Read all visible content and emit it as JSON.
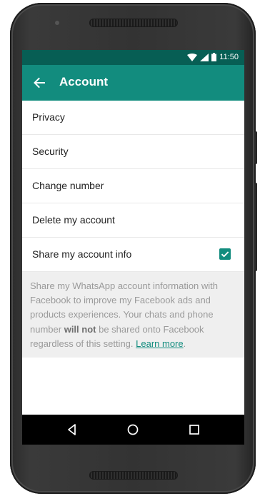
{
  "status_bar": {
    "time": "11:50",
    "icons": [
      "wifi-icon",
      "signal-icon",
      "battery-icon"
    ]
  },
  "app_bar": {
    "title": "Account",
    "back_icon": "back-arrow-icon"
  },
  "settings": {
    "items": [
      {
        "label": "Privacy"
      },
      {
        "label": "Security"
      },
      {
        "label": "Change number"
      },
      {
        "label": "Delete my account"
      },
      {
        "label": "Share my account info",
        "checked": true
      }
    ],
    "info": {
      "text_1": "Share my WhatsApp account information with Facebook to improve my Facebook ads and products experiences. Your chats and phone number ",
      "bold": "will not",
      "text_2": " be shared onto Facebook regardless of this setting. ",
      "link": "Learn more",
      "text_3": "."
    }
  },
  "nav_bar": {
    "buttons": [
      "back-triangle-icon",
      "home-circle-icon",
      "recents-square-icon"
    ]
  },
  "colors": {
    "status_bar": "#075e54",
    "app_bar": "#128c7e",
    "accent": "#128c7e"
  }
}
